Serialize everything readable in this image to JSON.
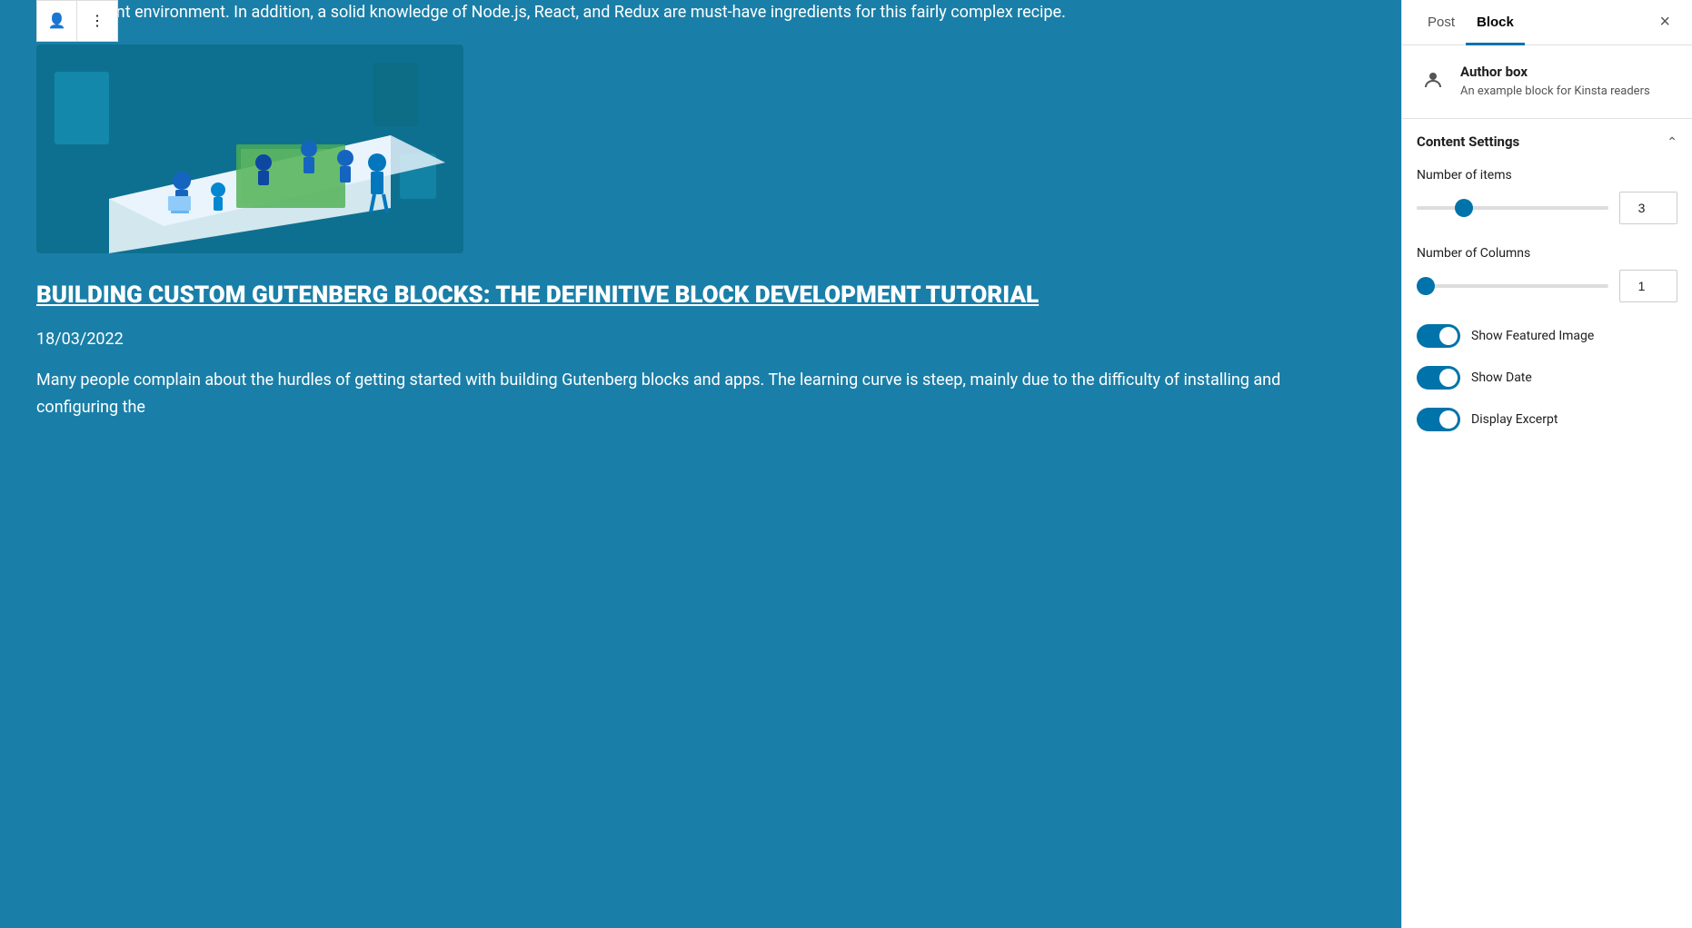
{
  "sidebar": {
    "tabs": [
      {
        "id": "post",
        "label": "Post",
        "active": false
      },
      {
        "id": "block",
        "label": "Block",
        "active": true
      }
    ],
    "close_label": "×",
    "block_info": {
      "name": "Author box",
      "description": "An example block for Kinsta readers"
    },
    "content_settings": {
      "title": "Content Settings",
      "number_of_items": {
        "label": "Number of items",
        "value": 3,
        "min": 1,
        "max": 10,
        "fill_percent": 25
      },
      "number_of_columns": {
        "label": "Number of Columns",
        "value": 1,
        "min": 1,
        "max": 6,
        "fill_percent": 0
      },
      "show_featured_image": {
        "label": "Show Featured Image",
        "enabled": true
      },
      "show_date": {
        "label": "Show Date",
        "enabled": true
      },
      "display_excerpt": {
        "label": "Display Excerpt",
        "enabled": true
      }
    }
  },
  "main": {
    "intro_text": "development environment. In addition, a solid knowledge of Node.js, React, and Redux are must-have ingredients for this fairly complex recipe.",
    "post_title": "BUILDING CUSTOM GUTENBERG BLOCKS: THE DEFINITIVE BLOCK DEVELOPMENT TUTORIAL",
    "post_date": "18/03/2022",
    "post_excerpt_1": "Many people complain about the hurdles of getting started with building Gutenberg blocks and apps. The learning curve is steep, mainly due to the difficulty of installing and configuring the",
    "post_excerpt_2": "development environment. In addition, a solid knowledge of"
  },
  "toolbar": {
    "author_icon": "👤",
    "more_icon": "⋮"
  }
}
